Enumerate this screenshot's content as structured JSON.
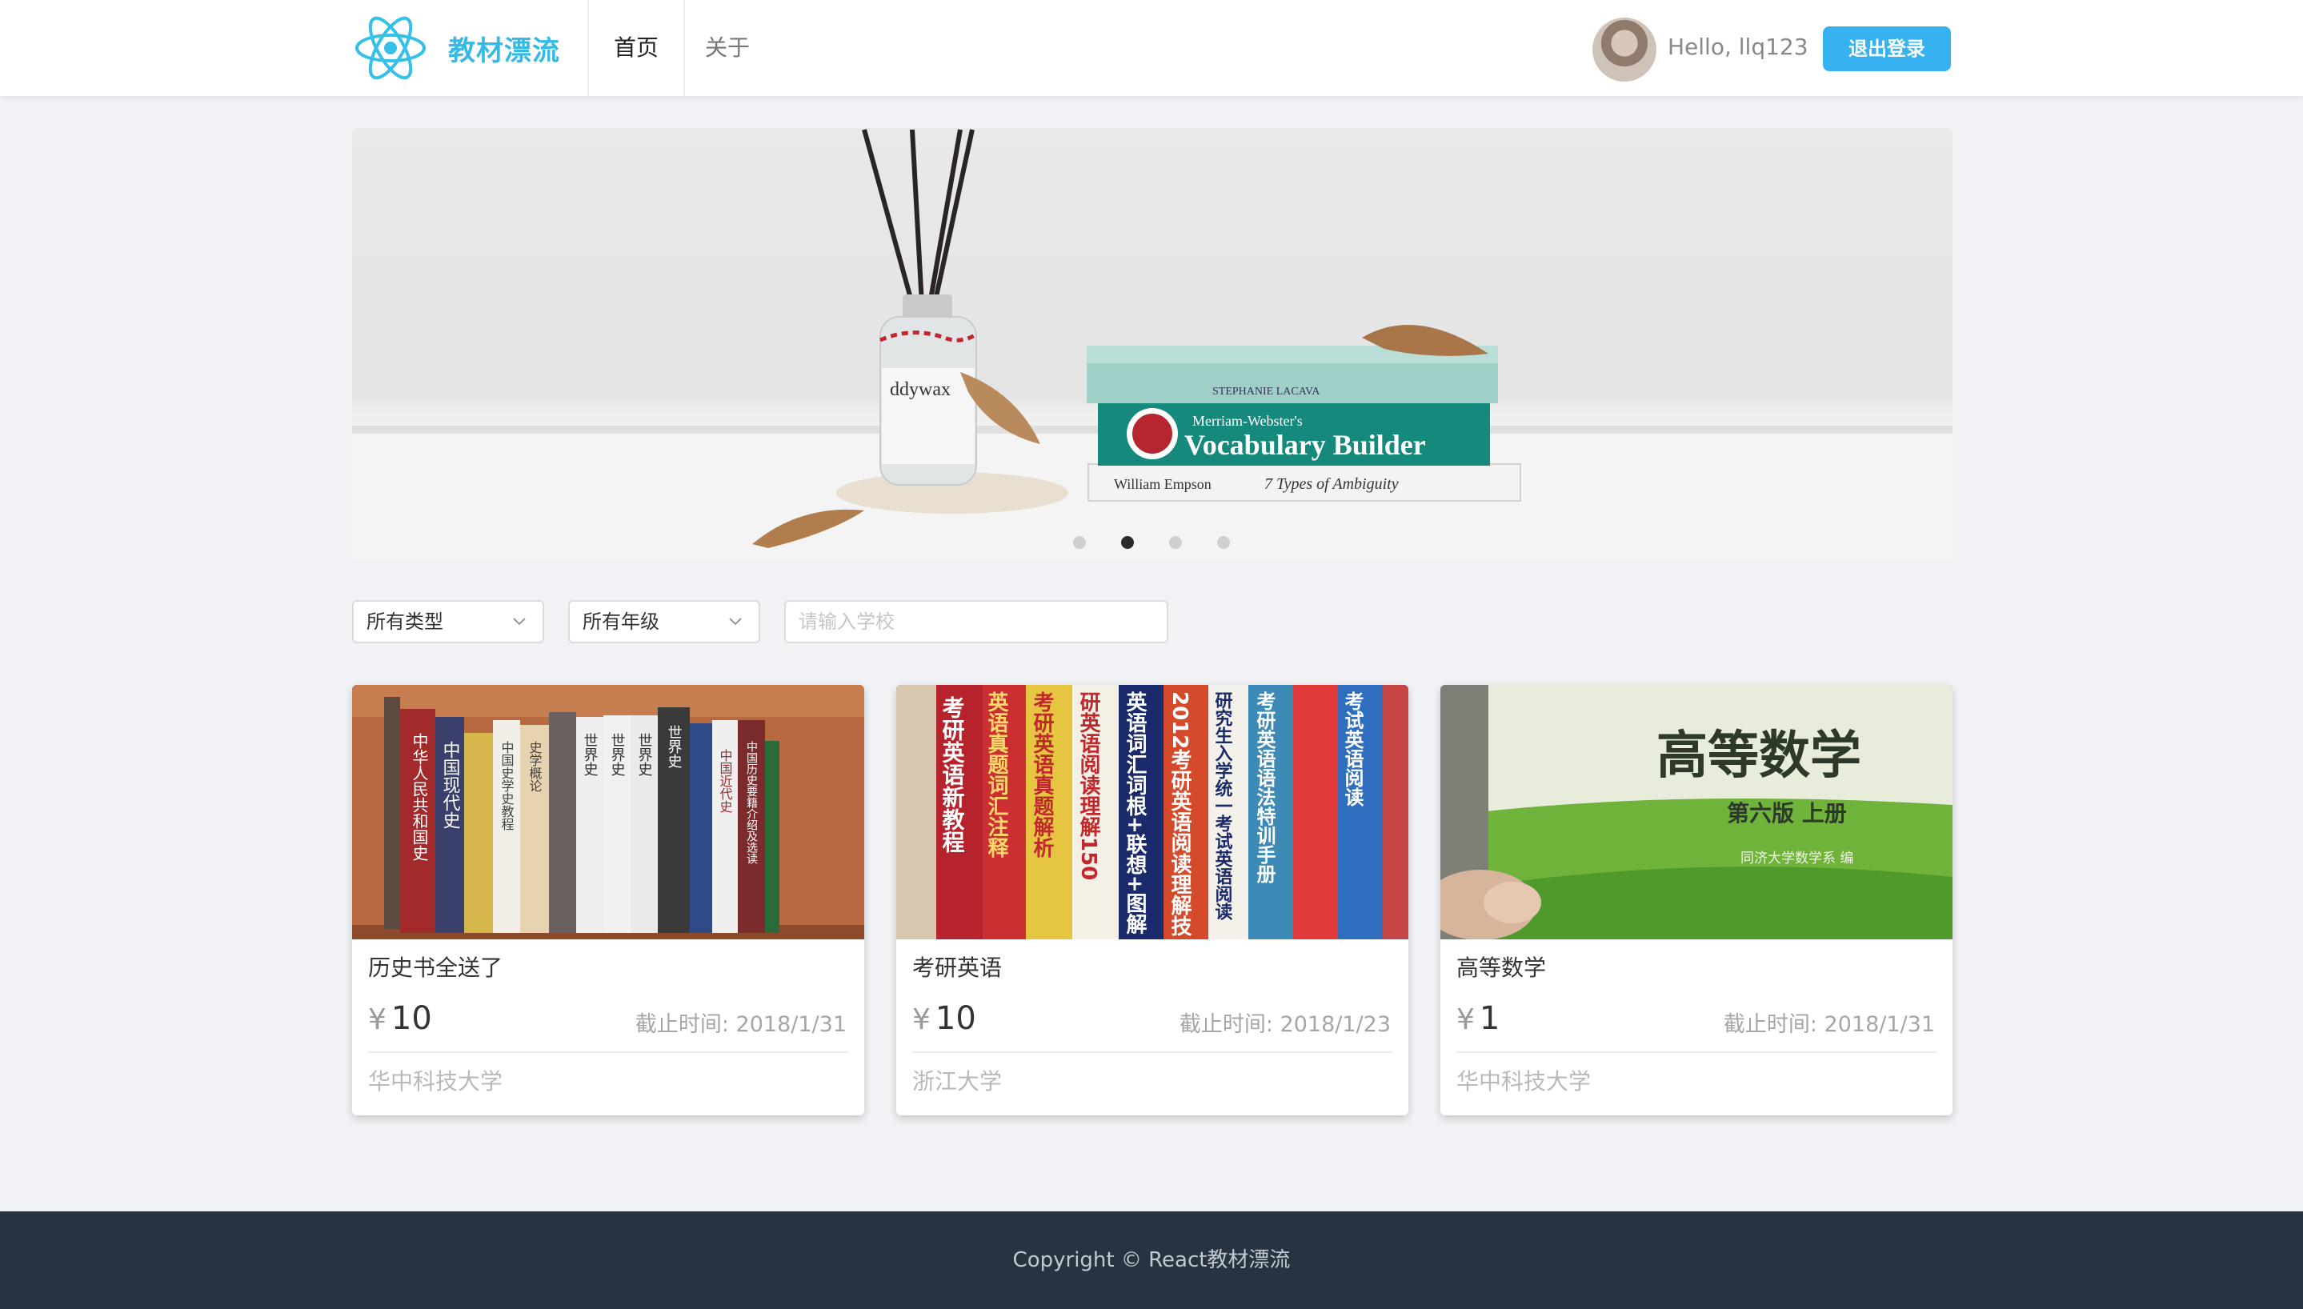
{
  "header": {
    "brand": "教材漂流",
    "nav": [
      {
        "label": "首页"
      },
      {
        "label": "关于"
      }
    ],
    "greeting": "Hello, llq123",
    "logout_label": "退出登录"
  },
  "banner": {
    "book_titles": [
      "Vocabulary Builder",
      "Merriam-Webster's",
      "7 Types of Ambiguity",
      "William Empson",
      "STEPHANIE LACAVA",
      "ddywax"
    ],
    "slide_count": 4,
    "active_slide": 2
  },
  "filters": {
    "type_select": "所有类型",
    "grade_select": "所有年级",
    "school_placeholder": "请输入学校"
  },
  "listings": [
    {
      "title": "历史书全送了",
      "currency": "¥",
      "price": "10",
      "deadline": "截止时间: 2018/1/31",
      "school": "华中科技大学"
    },
    {
      "title": "考研英语",
      "currency": "¥",
      "price": "10",
      "deadline": "截止时间: 2018/1/23",
      "school": "浙江大学"
    },
    {
      "title": "高等数学",
      "currency": "¥",
      "price": "1",
      "deadline": "截止时间: 2018/1/31",
      "school": "华中科技大学"
    }
  ],
  "cover_text": {
    "math_title": "高等数学",
    "math_edition": "第六版  上册",
    "math_author": "同济大学数学系  编",
    "english_spines": [
      "考研英语新教程",
      "英语真题词汇注释",
      "考研英语真题解析",
      "研英语阅读理解150",
      "英语词汇词根+联想+图解",
      "2012考研英语阅读理解技",
      "研究生入学统一考试英语阅读",
      "考研英语语法特训手册",
      "考试英语阅读"
    ],
    "history_spines": [
      "中华人民共和国史",
      "中国现代史",
      "中国史学史教程",
      "史学概论",
      "世界史",
      "世界史",
      "世界史",
      "世界史",
      "中国近代史",
      "中国历史要籍介绍及选读"
    ]
  },
  "footer": {
    "copyright": "Copyright © React教材漂流"
  }
}
